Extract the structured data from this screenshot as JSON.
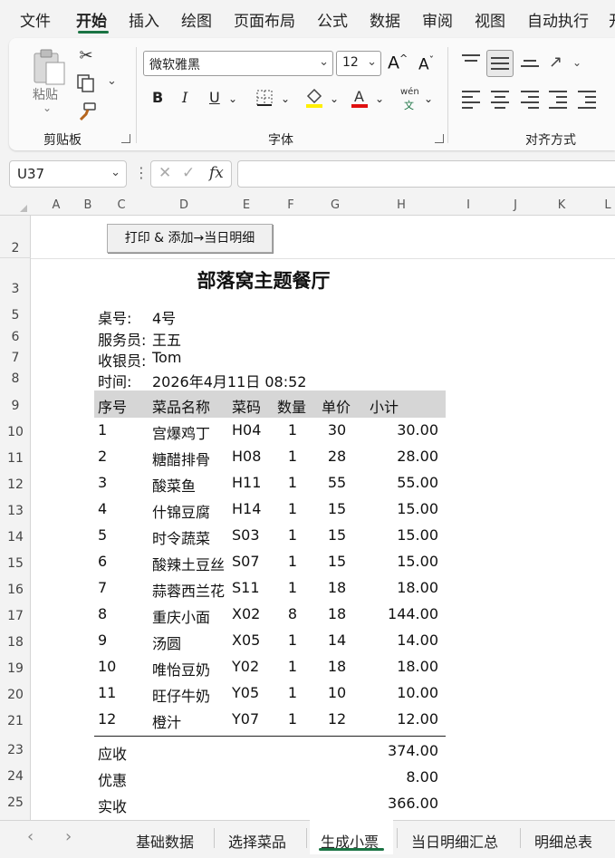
{
  "menu": {
    "tabs": [
      "文件",
      "开始",
      "插入",
      "绘图",
      "页面布局",
      "公式",
      "数据",
      "审阅",
      "视图",
      "自动执行",
      "开"
    ],
    "active": "开始"
  },
  "ribbon": {
    "clipboard": {
      "label": "剪贴板",
      "paste_label": "粘贴"
    },
    "font": {
      "label": "字体",
      "font_name": "微软雅黑",
      "font_size": "12",
      "phonetic_top": "wén",
      "phonetic_bottom": "文"
    },
    "alignment": {
      "label": "对齐方式"
    }
  },
  "formula_bar": {
    "name_box": "U37",
    "fx_label": "fx",
    "value": ""
  },
  "columns": [
    "A",
    "B",
    "C",
    "D",
    "E",
    "F",
    "G",
    "H",
    "I",
    "J",
    "K",
    "L"
  ],
  "rows": [
    "2",
    "3",
    "5",
    "6",
    "7",
    "8",
    "9",
    "10",
    "11",
    "12",
    "13",
    "14",
    "15",
    "16",
    "17",
    "18",
    "19",
    "20",
    "21",
    "23",
    "24",
    "25"
  ],
  "sheet": {
    "button_label": "打印 & 添加→当日明细",
    "title": "部落窝主题餐厅",
    "info": [
      {
        "label": "桌号:",
        "value": "4号"
      },
      {
        "label": "服务员:",
        "value": "王五"
      },
      {
        "label": "收银员:",
        "value": "Tom"
      },
      {
        "label": "时间:",
        "value": "2026年4月11日 08:52"
      }
    ],
    "table_headers": [
      "序号",
      "菜品名称",
      "菜码",
      "数量",
      "单价",
      "小计"
    ],
    "items": [
      {
        "no": "1",
        "name": "宫爆鸡丁",
        "code": "H04",
        "qty": "1",
        "price": "30",
        "subtotal": "30.00"
      },
      {
        "no": "2",
        "name": "糖醋排骨",
        "code": "H08",
        "qty": "1",
        "price": "28",
        "subtotal": "28.00"
      },
      {
        "no": "3",
        "name": "酸菜鱼",
        "code": "H11",
        "qty": "1",
        "price": "55",
        "subtotal": "55.00"
      },
      {
        "no": "4",
        "name": "什锦豆腐",
        "code": "H14",
        "qty": "1",
        "price": "15",
        "subtotal": "15.00"
      },
      {
        "no": "5",
        "name": "时令蔬菜",
        "code": "S03",
        "qty": "1",
        "price": "15",
        "subtotal": "15.00"
      },
      {
        "no": "6",
        "name": "酸辣土豆丝",
        "code": "S07",
        "qty": "1",
        "price": "15",
        "subtotal": "15.00"
      },
      {
        "no": "7",
        "name": "蒜蓉西兰花",
        "code": "S11",
        "qty": "1",
        "price": "18",
        "subtotal": "18.00"
      },
      {
        "no": "8",
        "name": "重庆小面",
        "code": "X02",
        "qty": "8",
        "price": "18",
        "subtotal": "144.00"
      },
      {
        "no": "9",
        "name": "汤圆",
        "code": "X05",
        "qty": "1",
        "price": "14",
        "subtotal": "14.00"
      },
      {
        "no": "10",
        "name": "唯怡豆奶",
        "code": "Y02",
        "qty": "1",
        "price": "18",
        "subtotal": "18.00"
      },
      {
        "no": "11",
        "name": "旺仔牛奶",
        "code": "Y05",
        "qty": "1",
        "price": "10",
        "subtotal": "10.00"
      },
      {
        "no": "12",
        "name": "橙汁",
        "code": "Y07",
        "qty": "1",
        "price": "12",
        "subtotal": "12.00"
      }
    ],
    "totals": [
      {
        "label": "应收",
        "value": "374.00"
      },
      {
        "label": "优惠",
        "value": "8.00"
      },
      {
        "label": "实收",
        "value": "366.00"
      }
    ]
  },
  "sheet_tabs": [
    "基础数据",
    "选择菜品",
    "生成小票",
    "当日明细汇总",
    "明细总表"
  ],
  "active_sheet": "生成小票",
  "colors": {
    "accent": "#1a7343",
    "header_band": "#d6d6d6"
  }
}
